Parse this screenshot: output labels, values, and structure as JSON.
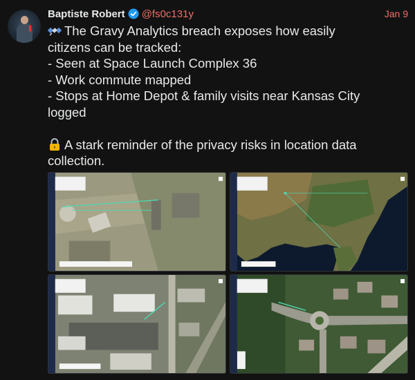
{
  "author": {
    "display_name": "Baptiste Robert",
    "handle": "@fs0c131y",
    "verified": true,
    "avatar_icon": "profile-photo"
  },
  "date": "Jan 9",
  "text_lines": [
    "The Gravy Analytics breach exposes how easily",
    "citizens can be tracked:",
    "- Seen at Space Launch Complex 36",
    "- Work commute mapped",
    "- Stops at Home Depot & family visits near Kansas City",
    "logged",
    "",
    "A stark reminder of the privacy risks in location data",
    "collection."
  ],
  "emojis": {
    "line0": "satellite-emoji",
    "line7": "lock-emoji"
  },
  "media": [
    {
      "name": "map-screenshot-launch-complex",
      "icon": "satellite-map"
    },
    {
      "name": "map-screenshot-us-southeast",
      "icon": "satellite-map"
    },
    {
      "name": "map-screenshot-home-depot",
      "icon": "satellite-map"
    },
    {
      "name": "map-screenshot-neighborhood",
      "icon": "satellite-map"
    }
  ],
  "colors": {
    "background": "#121212",
    "text": "#e7e9ea",
    "handle": "#f0706a",
    "verified": "#1d9bf0",
    "map_panel": "#1d2a4a"
  }
}
